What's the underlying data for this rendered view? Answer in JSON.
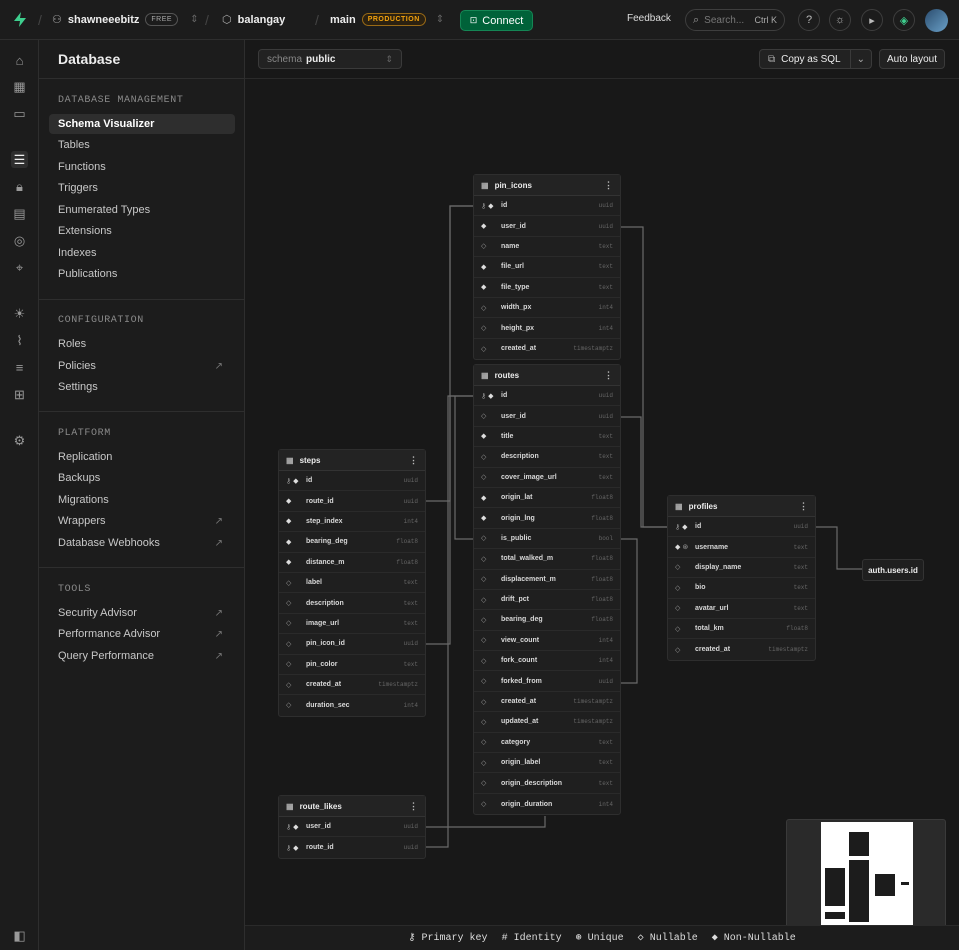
{
  "topbar": {
    "org": "shawneeebitz",
    "org_plan": "FREE",
    "project": "balangay",
    "branch": "main",
    "branch_badge": "PRODUCTION",
    "connect_label": "Connect",
    "feedback_label": "Feedback",
    "search_placeholder": "Search...",
    "search_shortcut": "Ctrl K"
  },
  "sidebar": {
    "title": "Database",
    "sections": {
      "management": "DATABASE MANAGEMENT",
      "configuration": "CONFIGURATION",
      "platform": "PLATFORM",
      "tools": "TOOLS"
    },
    "management_items": [
      "Schema Visualizer",
      "Tables",
      "Functions",
      "Triggers",
      "Enumerated Types",
      "Extensions",
      "Indexes",
      "Publications"
    ],
    "configuration_items": [
      "Roles",
      "Policies",
      "Settings"
    ],
    "platform_items": [
      "Replication",
      "Backups",
      "Migrations",
      "Wrappers",
      "Database Webhooks"
    ],
    "tools_items": [
      "Security Advisor",
      "Performance Advisor",
      "Query Performance"
    ]
  },
  "toolbar": {
    "schema_prefix": "schema",
    "schema_value": "public",
    "copy_sql": "Copy as SQL",
    "auto_layout": "Auto layout"
  },
  "tables": {
    "pin_icons": {
      "name": "pin_icons",
      "rows": [
        [
          "id",
          "uuid"
        ],
        [
          "user_id",
          "uuid"
        ],
        [
          "name",
          "text"
        ],
        [
          "file_url",
          "text"
        ],
        [
          "file_type",
          "text"
        ],
        [
          "width_px",
          "int4"
        ],
        [
          "height_px",
          "int4"
        ],
        [
          "created_at",
          "timestamptz"
        ]
      ]
    },
    "routes": {
      "name": "routes",
      "rows": [
        [
          "id",
          "uuid"
        ],
        [
          "user_id",
          "uuid"
        ],
        [
          "title",
          "text"
        ],
        [
          "description",
          "text"
        ],
        [
          "cover_image_url",
          "text"
        ],
        [
          "origin_lat",
          "float8"
        ],
        [
          "origin_lng",
          "float8"
        ],
        [
          "is_public",
          "bool"
        ],
        [
          "total_walked_m",
          "float8"
        ],
        [
          "displacement_m",
          "float8"
        ],
        [
          "drift_pct",
          "float8"
        ],
        [
          "bearing_deg",
          "float8"
        ],
        [
          "view_count",
          "int4"
        ],
        [
          "fork_count",
          "int4"
        ],
        [
          "forked_from",
          "uuid"
        ],
        [
          "created_at",
          "timestamptz"
        ],
        [
          "updated_at",
          "timestamptz"
        ],
        [
          "category",
          "text"
        ],
        [
          "origin_label",
          "text"
        ],
        [
          "origin_description",
          "text"
        ],
        [
          "origin_duration",
          "int4"
        ]
      ]
    },
    "steps": {
      "name": "steps",
      "rows": [
        [
          "id",
          "uuid"
        ],
        [
          "route_id",
          "uuid"
        ],
        [
          "step_index",
          "int4"
        ],
        [
          "bearing_deg",
          "float8"
        ],
        [
          "distance_m",
          "float8"
        ],
        [
          "label",
          "text"
        ],
        [
          "description",
          "text"
        ],
        [
          "image_url",
          "text"
        ],
        [
          "pin_icon_id",
          "uuid"
        ],
        [
          "pin_color",
          "text"
        ],
        [
          "created_at",
          "timestamptz"
        ],
        [
          "duration_sec",
          "int4"
        ]
      ]
    },
    "profiles": {
      "name": "profiles",
      "rows": [
        [
          "id",
          "uuid"
        ],
        [
          "username",
          "text"
        ],
        [
          "display_name",
          "text"
        ],
        [
          "bio",
          "text"
        ],
        [
          "avatar_url",
          "text"
        ],
        [
          "total_km",
          "float8"
        ],
        [
          "created_at",
          "timestamptz"
        ]
      ]
    },
    "route_likes": {
      "name": "route_likes",
      "rows": [
        [
          "user_id",
          "uuid"
        ],
        [
          "route_id",
          "uuid"
        ]
      ]
    }
  },
  "auth_node": "auth.users.id",
  "legend": {
    "primary_key": "Primary key",
    "identity": "Identity",
    "unique": "Unique",
    "nullable": "Nullable",
    "non_nullable": "Non-Nullable"
  }
}
